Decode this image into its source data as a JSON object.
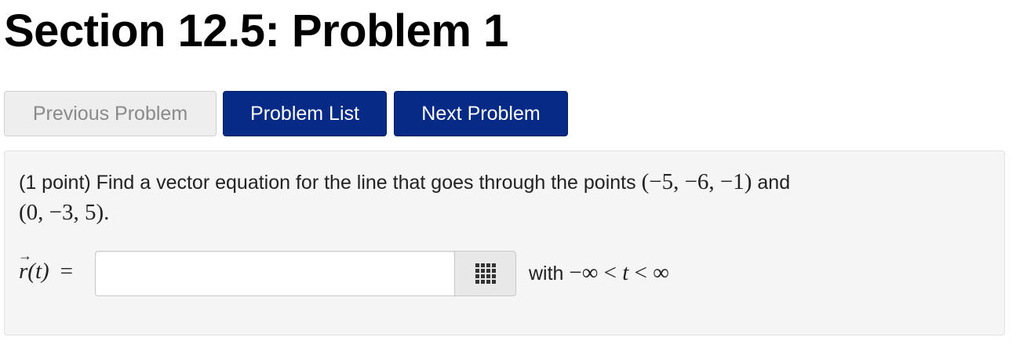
{
  "page": {
    "title": "Section 12.5: Problem 1"
  },
  "nav": {
    "previous_label": "Previous Problem",
    "list_label": "Problem List",
    "next_label": "Next Problem"
  },
  "problem": {
    "text_prefix": "(1 point) Find a vector equation for the line that goes through the points ",
    "point1": "(−5, −6, −1)",
    "conjunction": " and",
    "point2": "(0, −3, 5).",
    "answer_label_var": "r",
    "answer_label_arrow": "→",
    "answer_label_arg": "(t)",
    "answer_label_eq": "=",
    "answer_value": "",
    "answer_placeholder": "",
    "range_word": "with ",
    "range_expr_left": "−∞ < ",
    "range_var": "t",
    "range_expr_right": " < ∞"
  },
  "icons": {
    "math_entry": "grid-icon"
  },
  "colors": {
    "primary_button": "#062a86",
    "disabled_button": "#eeeeee",
    "problem_background": "#f5f5f5"
  }
}
